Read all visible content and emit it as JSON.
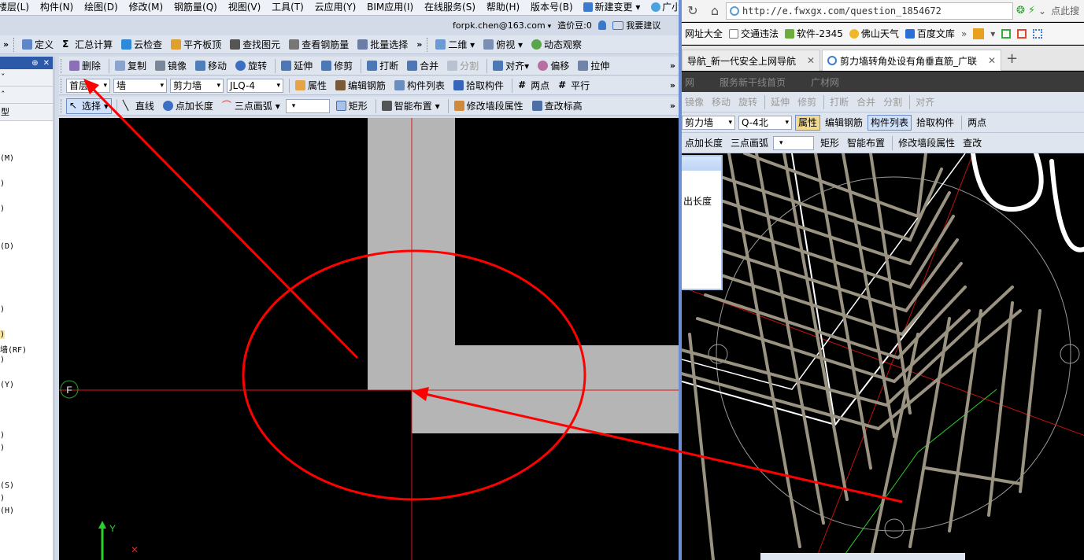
{
  "left_app": {
    "menu": [
      "楼层(L)",
      "构件(N)",
      "绘图(D)",
      "修改(M)",
      "钢筋量(Q)",
      "视图(V)",
      "工具(T)",
      "云应用(Y)",
      "BIM应用(I)",
      "在线服务(S)",
      "帮助(H)",
      "版本号(B)",
      "新建变更",
      "广小二"
    ],
    "account": "forpk.chen@163.com",
    "beans": "造价豆:0",
    "suggest": "我要建议",
    "toolbar1": [
      "定义",
      "汇总计算",
      "云检查",
      "平齐板顶",
      "查找图元",
      "查看钢筋量",
      "批量选择"
    ],
    "view_mode": "二维",
    "view_angle": "俯视",
    "dynamic_view": "动态观察",
    "toolbar2": [
      "删除",
      "复制",
      "镜像",
      "移动",
      "旋转",
      "延伸",
      "修剪",
      "打断",
      "合并",
      "分割",
      "对齐",
      "偏移",
      "拉伸"
    ],
    "floor": "首层",
    "category": "墙",
    "type": "剪力墙",
    "component": "JLQ-4",
    "toolbar3": [
      "属性",
      "编辑钢筋",
      "构件列表",
      "拾取构件",
      "两点",
      "平行"
    ],
    "toolbar4": [
      "选择",
      "直线",
      "点加长度",
      "三点画弧",
      "矩形",
      "智能布置",
      "修改墙段属性",
      "查改标高"
    ],
    "side_tabs": [
      "ˇ",
      "ˆ",
      "型"
    ],
    "side_items": [
      "(M)",
      ")",
      ")",
      "(D)",
      ")",
      ")",
      "墙(RF)",
      ")",
      "(Y)",
      ")",
      ")",
      "(S)",
      ")",
      "(H)"
    ],
    "axis_label": "F",
    "y_axis": "Y"
  },
  "browser": {
    "url": "http://e.fwxgx.com/question_1854672",
    "search_tail": "点此搜",
    "bookmarks": [
      "网址大全",
      "交通违法",
      "软件-2345",
      "佛山天气",
      "百度文库"
    ],
    "tabs": [
      {
        "label": "导航_新一代安全上网导航",
        "active": false
      },
      {
        "label": "剪力墙转角处设有角垂直筋_广联",
        "active": true
      }
    ],
    "embedded": {
      "strip": [
        "网",
        "服务新干线首页",
        "广材网"
      ],
      "toolbar_edit": [
        "镜像",
        "移动",
        "旋转",
        "延伸",
        "修剪",
        "打断",
        "合并",
        "分割",
        "对齐"
      ],
      "type": "剪力墙",
      "component": "Q-4北",
      "toolbar_props": [
        "属性",
        "编辑钢筋",
        "构件列表",
        "拾取构件",
        "两点"
      ],
      "toolbar_draw": [
        "点加长度",
        "三点画弧",
        "矩形",
        "智能布置",
        "修改墙段属性",
        "查改"
      ],
      "dialog_label": "出长度"
    }
  },
  "colors": {
    "annotation": "#ff0000",
    "wall": "#b5b5b5",
    "rebar": "#9b9382",
    "browser_accent": "#6d8fd6"
  }
}
